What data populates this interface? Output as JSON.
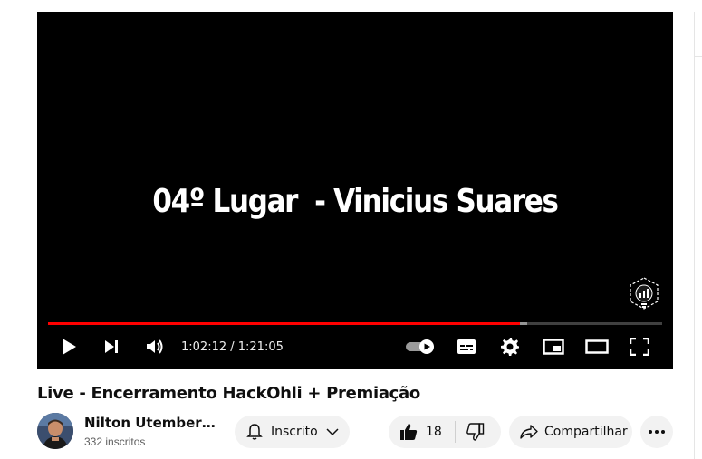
{
  "player": {
    "overlay_text": "04º Lugar  - Vinicius Suares",
    "time_display": "1:02:12 / 1:21:05",
    "progress_played": 0.769,
    "progress_buffered": 0.78,
    "autoplay_on": true
  },
  "video": {
    "title": "Live - Encerramento HackOhli + Premiação"
  },
  "channel": {
    "name": "Nilton Utembergu...",
    "subscribers": "332 inscritos"
  },
  "actions": {
    "subscribe_label": "Inscrito",
    "like_count": "18",
    "share_label": "Compartilhar"
  },
  "colors": {
    "progress": "#ff0000",
    "player_bg": "#000000",
    "pill_bg": "#f2f2f2"
  },
  "icons": {
    "play": "play-icon",
    "next": "next-icon",
    "volume": "volume-icon",
    "autoplay": "autoplay-toggle-icon",
    "captions": "captions-icon",
    "settings": "gear-icon",
    "miniplayer": "miniplayer-icon",
    "theater": "theater-mode-icon",
    "fullscreen": "fullscreen-icon",
    "bell": "bell-icon",
    "chevron": "chevron-down-icon",
    "like": "thumbs-up-icon",
    "dislike": "thumbs-down-icon",
    "share": "share-icon",
    "more": "more-icon"
  }
}
